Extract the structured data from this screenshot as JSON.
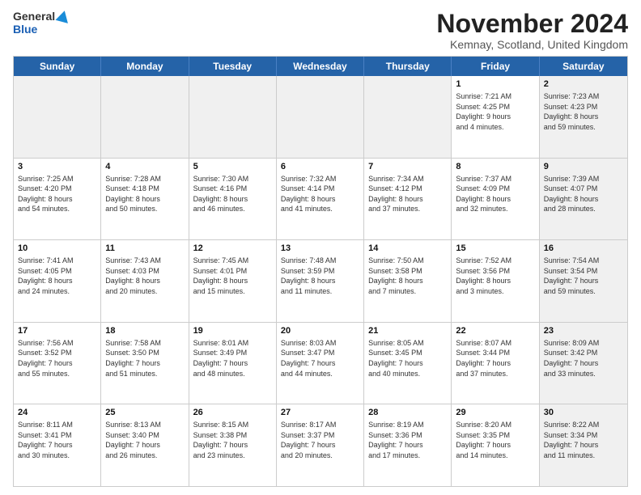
{
  "header": {
    "logo_general": "General",
    "logo_blue": "Blue",
    "month_title": "November 2024",
    "location": "Kemnay, Scotland, United Kingdom"
  },
  "weekdays": [
    "Sunday",
    "Monday",
    "Tuesday",
    "Wednesday",
    "Thursday",
    "Friday",
    "Saturday"
  ],
  "rows": [
    [
      {
        "day": "",
        "info": "",
        "shaded": true
      },
      {
        "day": "",
        "info": "",
        "shaded": true
      },
      {
        "day": "",
        "info": "",
        "shaded": true
      },
      {
        "day": "",
        "info": "",
        "shaded": true
      },
      {
        "day": "",
        "info": "",
        "shaded": true
      },
      {
        "day": "1",
        "info": "Sunrise: 7:21 AM\nSunset: 4:25 PM\nDaylight: 9 hours\nand 4 minutes.",
        "shaded": false
      },
      {
        "day": "2",
        "info": "Sunrise: 7:23 AM\nSunset: 4:23 PM\nDaylight: 8 hours\nand 59 minutes.",
        "shaded": true
      }
    ],
    [
      {
        "day": "3",
        "info": "Sunrise: 7:25 AM\nSunset: 4:20 PM\nDaylight: 8 hours\nand 54 minutes.",
        "shaded": false
      },
      {
        "day": "4",
        "info": "Sunrise: 7:28 AM\nSunset: 4:18 PM\nDaylight: 8 hours\nand 50 minutes.",
        "shaded": false
      },
      {
        "day": "5",
        "info": "Sunrise: 7:30 AM\nSunset: 4:16 PM\nDaylight: 8 hours\nand 46 minutes.",
        "shaded": false
      },
      {
        "day": "6",
        "info": "Sunrise: 7:32 AM\nSunset: 4:14 PM\nDaylight: 8 hours\nand 41 minutes.",
        "shaded": false
      },
      {
        "day": "7",
        "info": "Sunrise: 7:34 AM\nSunset: 4:12 PM\nDaylight: 8 hours\nand 37 minutes.",
        "shaded": false
      },
      {
        "day": "8",
        "info": "Sunrise: 7:37 AM\nSunset: 4:09 PM\nDaylight: 8 hours\nand 32 minutes.",
        "shaded": false
      },
      {
        "day": "9",
        "info": "Sunrise: 7:39 AM\nSunset: 4:07 PM\nDaylight: 8 hours\nand 28 minutes.",
        "shaded": true
      }
    ],
    [
      {
        "day": "10",
        "info": "Sunrise: 7:41 AM\nSunset: 4:05 PM\nDaylight: 8 hours\nand 24 minutes.",
        "shaded": false
      },
      {
        "day": "11",
        "info": "Sunrise: 7:43 AM\nSunset: 4:03 PM\nDaylight: 8 hours\nand 20 minutes.",
        "shaded": false
      },
      {
        "day": "12",
        "info": "Sunrise: 7:45 AM\nSunset: 4:01 PM\nDaylight: 8 hours\nand 15 minutes.",
        "shaded": false
      },
      {
        "day": "13",
        "info": "Sunrise: 7:48 AM\nSunset: 3:59 PM\nDaylight: 8 hours\nand 11 minutes.",
        "shaded": false
      },
      {
        "day": "14",
        "info": "Sunrise: 7:50 AM\nSunset: 3:58 PM\nDaylight: 8 hours\nand 7 minutes.",
        "shaded": false
      },
      {
        "day": "15",
        "info": "Sunrise: 7:52 AM\nSunset: 3:56 PM\nDaylight: 8 hours\nand 3 minutes.",
        "shaded": false
      },
      {
        "day": "16",
        "info": "Sunrise: 7:54 AM\nSunset: 3:54 PM\nDaylight: 7 hours\nand 59 minutes.",
        "shaded": true
      }
    ],
    [
      {
        "day": "17",
        "info": "Sunrise: 7:56 AM\nSunset: 3:52 PM\nDaylight: 7 hours\nand 55 minutes.",
        "shaded": false
      },
      {
        "day": "18",
        "info": "Sunrise: 7:58 AM\nSunset: 3:50 PM\nDaylight: 7 hours\nand 51 minutes.",
        "shaded": false
      },
      {
        "day": "19",
        "info": "Sunrise: 8:01 AM\nSunset: 3:49 PM\nDaylight: 7 hours\nand 48 minutes.",
        "shaded": false
      },
      {
        "day": "20",
        "info": "Sunrise: 8:03 AM\nSunset: 3:47 PM\nDaylight: 7 hours\nand 44 minutes.",
        "shaded": false
      },
      {
        "day": "21",
        "info": "Sunrise: 8:05 AM\nSunset: 3:45 PM\nDaylight: 7 hours\nand 40 minutes.",
        "shaded": false
      },
      {
        "day": "22",
        "info": "Sunrise: 8:07 AM\nSunset: 3:44 PM\nDaylight: 7 hours\nand 37 minutes.",
        "shaded": false
      },
      {
        "day": "23",
        "info": "Sunrise: 8:09 AM\nSunset: 3:42 PM\nDaylight: 7 hours\nand 33 minutes.",
        "shaded": true
      }
    ],
    [
      {
        "day": "24",
        "info": "Sunrise: 8:11 AM\nSunset: 3:41 PM\nDaylight: 7 hours\nand 30 minutes.",
        "shaded": false
      },
      {
        "day": "25",
        "info": "Sunrise: 8:13 AM\nSunset: 3:40 PM\nDaylight: 7 hours\nand 26 minutes.",
        "shaded": false
      },
      {
        "day": "26",
        "info": "Sunrise: 8:15 AM\nSunset: 3:38 PM\nDaylight: 7 hours\nand 23 minutes.",
        "shaded": false
      },
      {
        "day": "27",
        "info": "Sunrise: 8:17 AM\nSunset: 3:37 PM\nDaylight: 7 hours\nand 20 minutes.",
        "shaded": false
      },
      {
        "day": "28",
        "info": "Sunrise: 8:19 AM\nSunset: 3:36 PM\nDaylight: 7 hours\nand 17 minutes.",
        "shaded": false
      },
      {
        "day": "29",
        "info": "Sunrise: 8:20 AM\nSunset: 3:35 PM\nDaylight: 7 hours\nand 14 minutes.",
        "shaded": false
      },
      {
        "day": "30",
        "info": "Sunrise: 8:22 AM\nSunset: 3:34 PM\nDaylight: 7 hours\nand 11 minutes.",
        "shaded": true
      }
    ]
  ]
}
